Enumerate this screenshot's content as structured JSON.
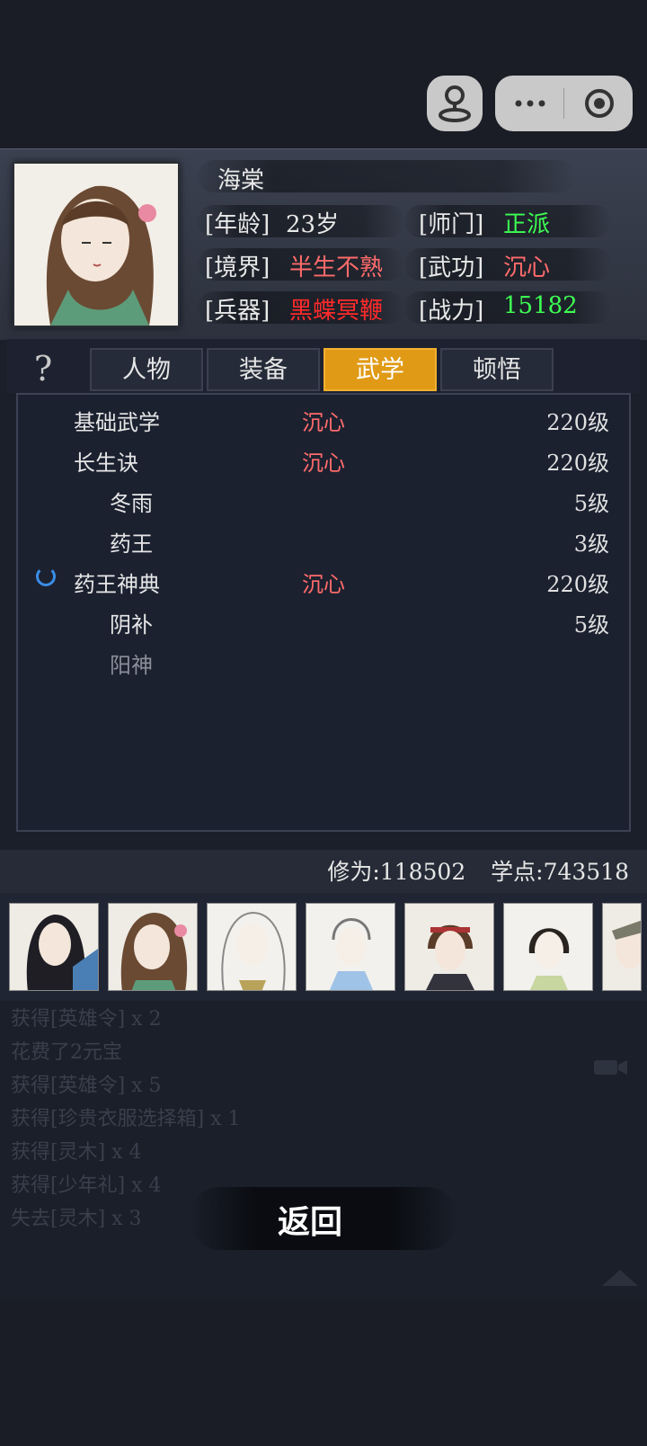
{
  "character": {
    "name": "海棠",
    "age_label": "[年龄]",
    "age_value": "23岁",
    "sect_label": "[师门]",
    "sect_value": "正派",
    "realm_label": "[境界]",
    "realm_value": "半生不熟",
    "martial_label": "[武功]",
    "martial_value": "沉心",
    "weapon_label": "[兵器]",
    "weapon_value": "黑蝶冥鞭",
    "power_label": "[战力]",
    "power_value": "15182"
  },
  "tabs": [
    {
      "label": "人物",
      "active": false
    },
    {
      "label": "装备",
      "active": false
    },
    {
      "label": "武学",
      "active": true
    },
    {
      "label": "顿悟",
      "active": false
    }
  ],
  "help_symbol": "?",
  "skills": [
    {
      "name": "基础武学",
      "state": "沉心",
      "level": "220级"
    },
    {
      "name": "长生诀",
      "state": "沉心",
      "level": "220级"
    },
    {
      "name": "冬雨",
      "state": "",
      "level": "5级"
    },
    {
      "name": "药王",
      "state": "",
      "level": "3级"
    },
    {
      "name": "药王神典",
      "state": "沉心",
      "level": "220级"
    },
    {
      "name": "阴补",
      "state": "",
      "level": "5级"
    },
    {
      "name": "阳神",
      "state": "",
      "level": ""
    }
  ],
  "stats": {
    "cultivation": "修为:118502",
    "points": "学点:743518"
  },
  "log": [
    "获得[英雄令] x 2",
    "花费了2元宝",
    "获得[英雄令] x 5",
    "获得[珍贵衣服选择箱] x 1",
    "获得[灵木] x 4",
    "获得[少年礼] x 4",
    "失去[灵木] x 3"
  ],
  "back_label": "返回",
  "colors": {
    "accent_tab": "#e09a16",
    "state_red": "#ff6b6b",
    "weapon_red": "#ff2a2a",
    "green": "#3dff52"
  }
}
